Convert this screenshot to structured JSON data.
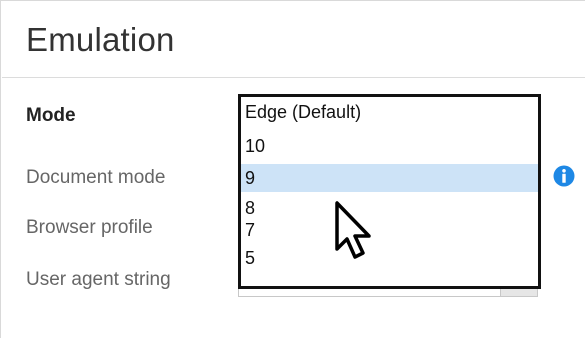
{
  "panel": {
    "title": "Emulation"
  },
  "fields": {
    "mode_label": "Mode",
    "document_mode_label": "Document mode",
    "browser_profile_label": "Browser profile",
    "user_agent_label": "User agent string"
  },
  "mode_dropdown": {
    "options": [
      "Edge (Default)",
      "10",
      "9",
      "8",
      "7",
      "5"
    ],
    "highlighted": "9"
  },
  "icons": {
    "info": "info-icon",
    "cursor": "mouse-pointer-icon"
  },
  "colors": {
    "highlight": "#cde3f7",
    "info_blue": "#1e88e5"
  }
}
